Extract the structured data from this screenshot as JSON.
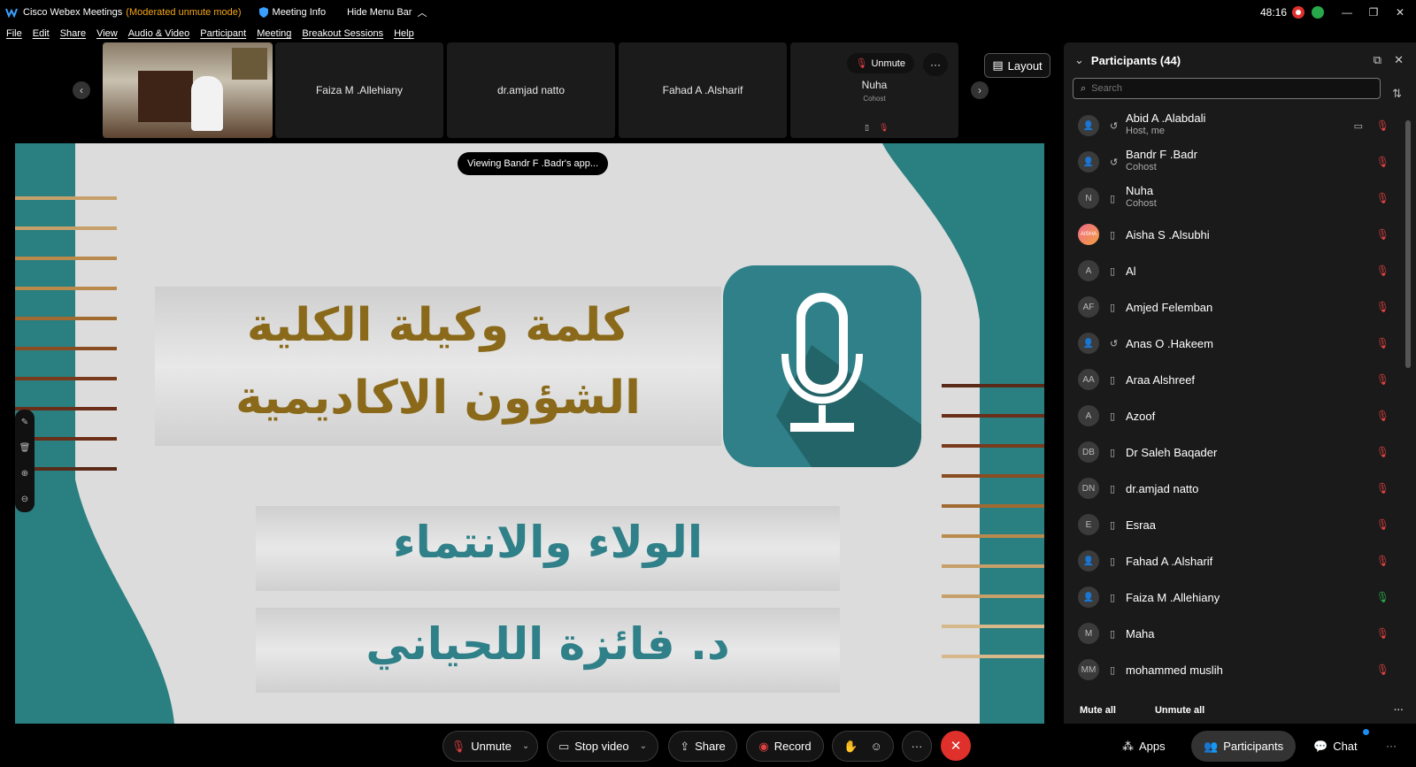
{
  "titlebar": {
    "app_title": "Cisco Webex Meetings",
    "mode": "(Moderated unmute mode)",
    "meeting_info": "Meeting Info",
    "hide_menu": "Hide Menu Bar",
    "timer": "48:16",
    "minimize": "—",
    "restore": "❐",
    "close": "✕"
  },
  "menu": [
    "File",
    "Edit",
    "Share",
    "View",
    "Audio & Video",
    "Participant",
    "Meeting",
    "Breakout Sessions",
    "Help"
  ],
  "strip": {
    "tiles": [
      {
        "name": "Faiza M .Allehiany"
      },
      {
        "name": "dr.amjad natto"
      },
      {
        "name": "Fahad A .Alsharif"
      },
      {
        "name": "Nuha",
        "sub": "Cohost"
      }
    ],
    "unmute_label": "Unmute",
    "layout_label": "Layout"
  },
  "share": {
    "viewing": "Viewing Bandr F .Badr's app...",
    "slide_line1": "كلمة وكيلة الكلية",
    "slide_line2": "الشؤون الاكاديمية",
    "slide_line3": "الولاء والانتماء",
    "slide_line4": "د. فائزة اللحياني"
  },
  "panel": {
    "title": "Participants (44)",
    "search_placeholder": "Search",
    "mute_all": "Mute all",
    "unmute_all": "Unmute all",
    "participants": [
      {
        "name": "Abid A .Alabdali",
        "role": "Host, me",
        "avatar": "",
        "mic": "muted",
        "video": true
      },
      {
        "name": "Bandr F .Badr",
        "role": "Cohost",
        "avatar": "",
        "mic": "muted"
      },
      {
        "name": "Nuha",
        "role": "Cohost",
        "avatar": "N",
        "mic": "muted"
      },
      {
        "name": "Aisha S .Alsubhi",
        "role": "",
        "avatar": "AISHA",
        "mic": "muted"
      },
      {
        "name": "Al",
        "role": "",
        "avatar": "A",
        "mic": "muted"
      },
      {
        "name": "Amjed Felemban",
        "role": "",
        "avatar": "AF",
        "mic": "muted"
      },
      {
        "name": "Anas O .Hakeem",
        "role": "",
        "avatar": "",
        "mic": "muted"
      },
      {
        "name": "Araa Alshreef",
        "role": "",
        "avatar": "AA",
        "mic": "muted"
      },
      {
        "name": "Azoof",
        "role": "",
        "avatar": "A",
        "mic": "muted"
      },
      {
        "name": "Dr Saleh Baqader",
        "role": "",
        "avatar": "DB",
        "mic": "muted"
      },
      {
        "name": "dr.amjad natto",
        "role": "",
        "avatar": "DN",
        "mic": "muted"
      },
      {
        "name": "Esraa",
        "role": "",
        "avatar": "E",
        "mic": "muted"
      },
      {
        "name": "Fahad A .Alsharif",
        "role": "",
        "avatar": "",
        "mic": "muted"
      },
      {
        "name": "Faiza M .Allehiany",
        "role": "",
        "avatar": "",
        "mic": "on"
      },
      {
        "name": "Maha",
        "role": "",
        "avatar": "M",
        "mic": "muted"
      },
      {
        "name": "mohammed muslih",
        "role": "",
        "avatar": "MM",
        "mic": "muted"
      }
    ]
  },
  "controls": {
    "unmute": "Unmute",
    "stop_video": "Stop video",
    "share": "Share",
    "record": "Record",
    "apps": "Apps",
    "participants": "Participants",
    "chat": "Chat"
  },
  "colors": {
    "accent_red": "#e0302c",
    "mode_orange": "#f2a516",
    "teal": "#2a7f80",
    "slide_gold": "#8a6a1a",
    "slide_teal": "#2f8088"
  }
}
